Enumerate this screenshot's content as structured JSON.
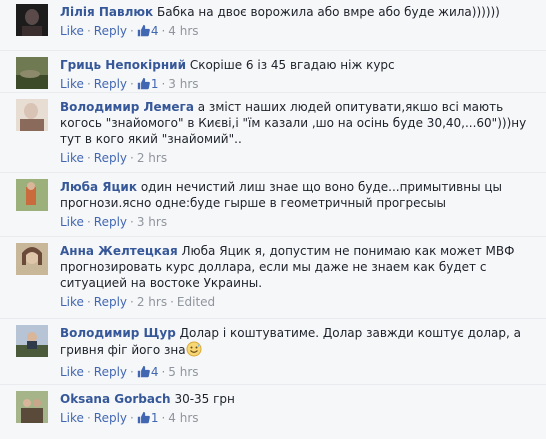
{
  "comments": [
    {
      "author": "Лілія Павлюк",
      "text": "Бабка на двоє ворожила або вмре або буде жила))))))",
      "like_label": "Like",
      "reply_label": "Reply",
      "likes": "4",
      "time": "4 hrs",
      "edited": "",
      "avatar_colors": [
        "#1c1c1c",
        "#5a4a4a"
      ]
    },
    {
      "author": "Гриць Непокірний",
      "text": "Скоріше 6 із 45 вгадаю ніж курс",
      "like_label": "Like",
      "reply_label": "Reply",
      "likes": "1",
      "time": "3 hrs",
      "edited": "",
      "avatar_colors": [
        "#6f7a52",
        "#3c4a2a"
      ]
    },
    {
      "author": "Володимир Лемега",
      "text": "а зміст наших людей опитувати,якшо всі мають когось \"знайомого\" в Києві,і \"їм казали ,шо на осінь буде 30,40,...60\")))ну тут в кого який \"знайомий\"..",
      "like_label": "Like",
      "reply_label": "Reply",
      "likes": "",
      "time": "2 hrs",
      "edited": "",
      "avatar_colors": [
        "#d9c3b5",
        "#8a6a5a"
      ]
    },
    {
      "author": "Люба Яцик",
      "text": "один нечистий лиш знае що воно буде...примытивны цы прогнози.ясно одне:буде гырше в геометричный прогресыы",
      "like_label": "Like",
      "reply_label": "Reply",
      "likes": "",
      "time": "3 hrs",
      "edited": "",
      "avatar_colors": [
        "#9bb07a",
        "#c96b3c"
      ]
    },
    {
      "author": "Анна Желтецкая",
      "text": "Люба Яцик я, допустим не понимаю как может МВФ прогнозировать курс доллара, если мы даже не знаем как будет с ситуацией на востоке Украины.",
      "like_label": "Like",
      "reply_label": "Reply",
      "likes": "",
      "time": "2 hrs",
      "edited": "Edited",
      "avatar_colors": [
        "#c9b79a",
        "#6b4a3a"
      ]
    },
    {
      "author": "Володимир Щур",
      "text": "Долар і коштуватиме. Долар завжди коштує долар, а гривня фіг його зна",
      "like_label": "Like",
      "reply_label": "Reply",
      "likes": "4",
      "time": "5 hrs",
      "edited": "",
      "avatar_colors": [
        "#b7c4d6",
        "#4a5a3a"
      ]
    },
    {
      "author": "Oksana Gorbach",
      "text": "30-35 грн",
      "like_label": "Like",
      "reply_label": "Reply",
      "likes": "1",
      "time": "4 hrs",
      "edited": "",
      "avatar_colors": [
        "#a6b48a",
        "#5a4a3a"
      ]
    }
  ],
  "colors": {
    "author": "#365899",
    "link": "#4267b2",
    "meta": "#90949c",
    "background": "#f6f7f9"
  }
}
